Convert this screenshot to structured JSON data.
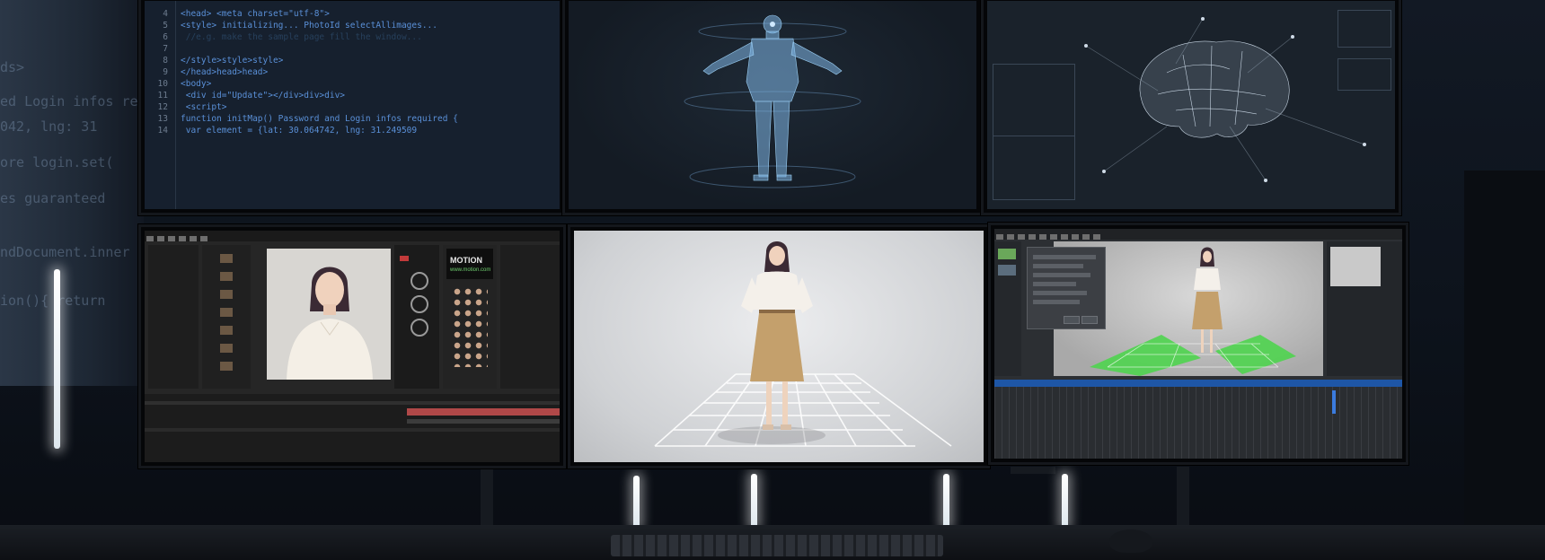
{
  "scene": {
    "code_monitor": {
      "lines": [
        {
          "num": "4",
          "text": "<head>     <meta charset=\"utf-8\">"
        },
        {
          "num": "5",
          "text": "<style> initializing... PhotoId selectAllimages..."
        },
        {
          "num": "6",
          "text": "           //e.g. make the sample page fill the window..."
        },
        {
          "num": "7",
          "text": ""
        },
        {
          "num": "8",
          "text": "</style>style>style>"
        },
        {
          "num": "9",
          "text": "</head>head>head>"
        },
        {
          "num": "10",
          "text": "<body>"
        },
        {
          "num": "11",
          "text": "  <div id=\"Update\"></div>div>div>"
        },
        {
          "num": "12",
          "text": "    <script>"
        },
        {
          "num": "13",
          "text": "function initMap() Password and Login infos required {"
        },
        {
          "num": "14",
          "text": "    var element = {lat: 30.064742, lng: 31.249509"
        }
      ]
    },
    "window_glare_text": [
      "ds>",
      "ed Login infos re",
      "042, lng: 31",
      "ore login.set(",
      "es guaranteed",
      "ndDocument.inner",
      "ion(){ return"
    ],
    "editor_monitor": {
      "brand_label": "MOTION",
      "brand_sub": "www.motion.com"
    },
    "colors": {
      "code_text": "#5a90d8",
      "code_bg": "#16202e",
      "green_floor": "#4fd44f",
      "timeline_red": "#b04848",
      "hologram": "#7fb6e6"
    }
  }
}
